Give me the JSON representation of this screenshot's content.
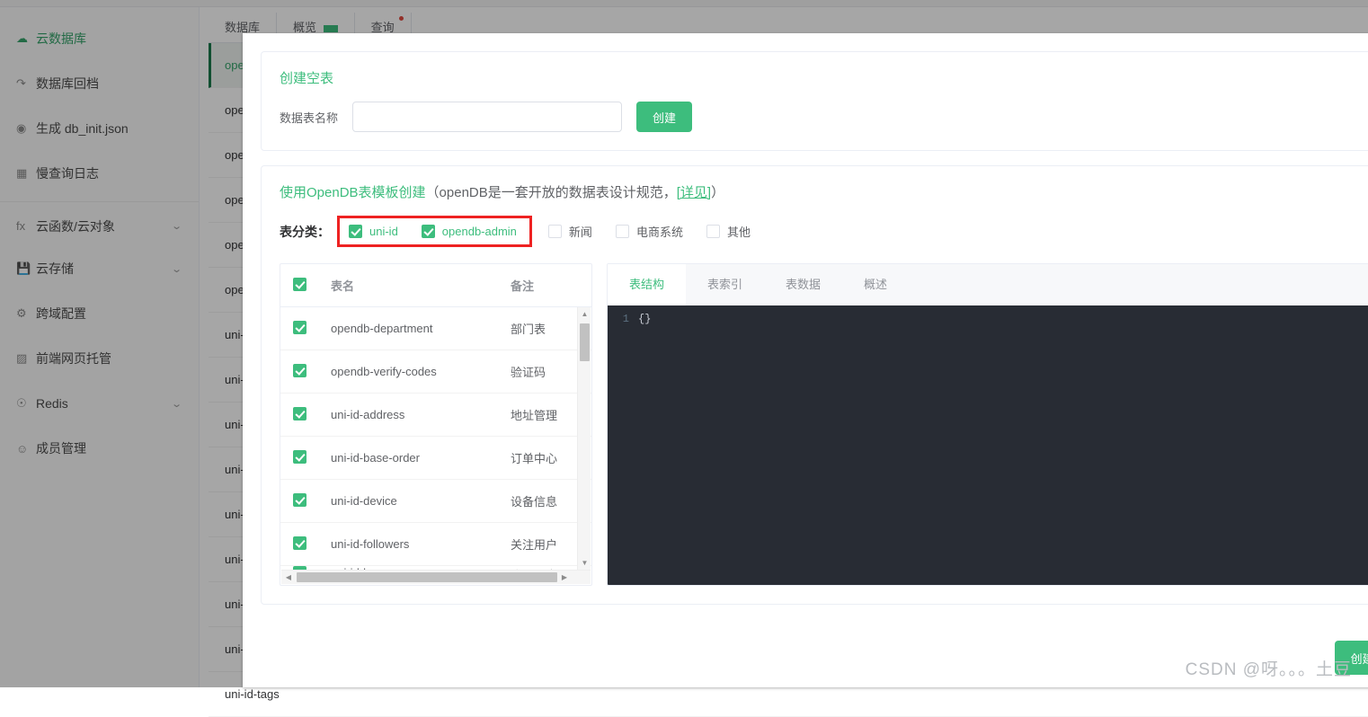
{
  "sidebar": {
    "items": [
      {
        "label": "云数据库",
        "icon": "cloud-database-icon",
        "active": true,
        "caret": false
      },
      {
        "label": "数据库回档",
        "icon": "rollback-icon",
        "active": false,
        "caret": false
      },
      {
        "label": "生成 db_init.json",
        "icon": "generate-icon",
        "active": false,
        "caret": false
      },
      {
        "label": "慢查询日志",
        "icon": "log-icon",
        "active": false,
        "caret": false
      },
      {
        "label": "云函数/云对象",
        "icon": "fx-icon",
        "active": false,
        "caret": true
      },
      {
        "label": "云存储",
        "icon": "storage-icon",
        "active": false,
        "caret": true
      },
      {
        "label": "跨域配置",
        "icon": "cors-icon",
        "active": false,
        "caret": false
      },
      {
        "label": "前端网页托管",
        "icon": "hosting-icon",
        "active": false,
        "caret": false
      },
      {
        "label": "Redis",
        "icon": "redis-icon",
        "active": false,
        "caret": true
      },
      {
        "label": "成员管理",
        "icon": "members-icon",
        "active": false,
        "caret": false
      }
    ]
  },
  "background": {
    "tabs": [
      {
        "label": "数据库"
      },
      {
        "label": "概览"
      },
      {
        "label": "查询"
      }
    ],
    "rows": [
      {
        "label": "opendb-admin-menus",
        "selected": true
      },
      {
        "label": "opendb-department"
      },
      {
        "label": "opendb-verify-codes"
      },
      {
        "label": "opendb-app-list"
      },
      {
        "label": "opendb-banner"
      },
      {
        "label": "opendb-city-china"
      },
      {
        "label": "uni-id-address"
      },
      {
        "label": "uni-id-base-order"
      },
      {
        "label": "uni-id-device"
      },
      {
        "label": "uni-id-followers"
      },
      {
        "label": "uni-id-log"
      },
      {
        "label": "uni-id-permissions"
      },
      {
        "label": "uni-id-roles"
      },
      {
        "label": "uni-id-scores"
      },
      {
        "label": "uni-id-tags"
      }
    ]
  },
  "modal": {
    "create_empty": {
      "title": "创建空表",
      "field_label": "数据表名称",
      "input_value": "",
      "input_placeholder": "",
      "button_label": "创建"
    },
    "opendb": {
      "title_green": "使用OpenDB表模板创建",
      "title_plain_open": "（openDB是一套开放的数据表设计规范，",
      "link_label": "[详见]",
      "title_plain_close": "）",
      "category_label": "表分类：",
      "highlight_color": "#ee2222",
      "accent_color": "#3dbd7d",
      "categories_highlighted": [
        {
          "label": "uni-id",
          "checked": true
        },
        {
          "label": "opendb-admin",
          "checked": true
        }
      ],
      "categories_other": [
        {
          "label": "新闻",
          "checked": false
        },
        {
          "label": "电商系统",
          "checked": false
        },
        {
          "label": "其他",
          "checked": false
        }
      ]
    },
    "table": {
      "header_checkbox_checked": true,
      "columns": [
        "表名",
        "备注"
      ],
      "rows": [
        {
          "checked": true,
          "name": "opendb-department",
          "note": "部门表"
        },
        {
          "checked": true,
          "name": "opendb-verify-codes",
          "note": "验证码"
        },
        {
          "checked": true,
          "name": "uni-id-address",
          "note": "地址管理"
        },
        {
          "checked": true,
          "name": "uni-id-base-order",
          "note": "订单中心"
        },
        {
          "checked": true,
          "name": "uni-id-device",
          "note": "设备信息"
        },
        {
          "checked": true,
          "name": "uni-id-followers",
          "note": "关注用户"
        },
        {
          "checked": true,
          "name": "uni-id-log",
          "note": "登录日志"
        }
      ]
    },
    "detail": {
      "tabs": [
        {
          "label": "表结构",
          "active": true
        },
        {
          "label": "表索引",
          "active": false
        },
        {
          "label": "表数据",
          "active": false
        },
        {
          "label": "概述",
          "active": false
        }
      ],
      "editor": {
        "line_number": "1",
        "code": "{}"
      }
    },
    "footer": {
      "submit_label": "创建选中的opendb表"
    }
  },
  "watermark": "CSDN @呀。。。土豆"
}
